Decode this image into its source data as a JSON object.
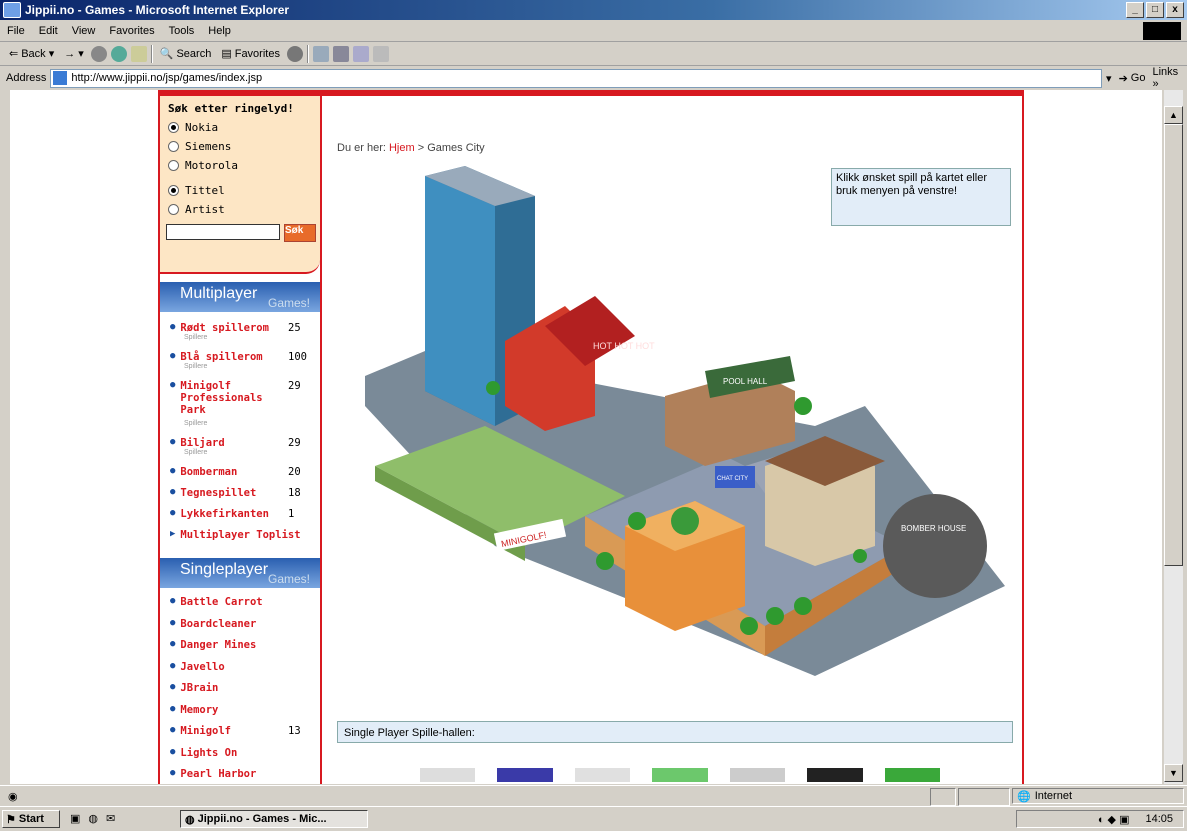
{
  "window": {
    "title": "Jippii.no - Games - Microsoft Internet Explorer",
    "controls": [
      "_",
      "□",
      "x"
    ]
  },
  "menu": [
    "File",
    "Edit",
    "View",
    "Favorites",
    "Tools",
    "Help"
  ],
  "toolbar": {
    "back": "Back",
    "search": "Search",
    "favorites": "Favorites"
  },
  "address": {
    "label": "Address",
    "url": "http://www.jippii.no/jsp/games/index.jsp",
    "go": "Go",
    "links": "Links »"
  },
  "search_box": {
    "title": "Søk etter ringelyd!",
    "phones": [
      {
        "label": "Nokia",
        "selected": true
      },
      {
        "label": "Siemens",
        "selected": false
      },
      {
        "label": "Motorola",
        "selected": false
      }
    ],
    "types": [
      {
        "label": "Tittel",
        "selected": true
      },
      {
        "label": "Artist",
        "selected": false
      }
    ],
    "button": "Søk"
  },
  "multiplayer": {
    "title": "Multiplayer",
    "sub": "Games!",
    "items": [
      {
        "label": "Rødt spillerom",
        "count": "25",
        "sub": "Spillere"
      },
      {
        "label": "Blå spillerom",
        "count": "100",
        "sub": "Spillere"
      },
      {
        "label": "Minigolf Professionals Park",
        "count": "29",
        "sub": "Spillere"
      },
      {
        "label": "Biljard",
        "count": "29",
        "sub": "Spillere"
      },
      {
        "label": "Bomberman",
        "count": "20",
        "sub": ""
      },
      {
        "label": "Tegnespillet",
        "count": "18",
        "sub": ""
      },
      {
        "label": "Lykkefirkanten",
        "count": "1",
        "sub": ""
      }
    ],
    "toplist": "Multiplayer Toplist"
  },
  "singleplayer": {
    "title": "Singleplayer",
    "sub": "Games!",
    "items": [
      {
        "label": "Battle Carrot",
        "count": ""
      },
      {
        "label": "Boardcleaner",
        "count": ""
      },
      {
        "label": "Danger Mines",
        "count": ""
      },
      {
        "label": "Javello",
        "count": ""
      },
      {
        "label": "JBrain",
        "count": ""
      },
      {
        "label": "Memory",
        "count": ""
      },
      {
        "label": "Minigolf",
        "count": "13"
      },
      {
        "label": "Lights On",
        "count": ""
      },
      {
        "label": "Pearl Harbor",
        "count": ""
      }
    ]
  },
  "breadcrumb": {
    "prefix": "Du er her:",
    "home": "Hjem",
    "sep": ">",
    "current": "Games City"
  },
  "hint": "Klikk ønsket spill på kartet eller bruk menyen på venstre!",
  "map_signs": {
    "hot": "HOT HOT HOT",
    "pool": "POOL HALL",
    "minigolf": "MINIGOLF!",
    "bomber": "BOMBER HOUSE",
    "city": "CHAT CITY"
  },
  "single_section": "Single Player Spille-hallen:",
  "status": {
    "zone": "Internet"
  },
  "taskbar": {
    "start": "Start",
    "task": "Jippii.no - Games - Mic...",
    "time": "14:05"
  }
}
